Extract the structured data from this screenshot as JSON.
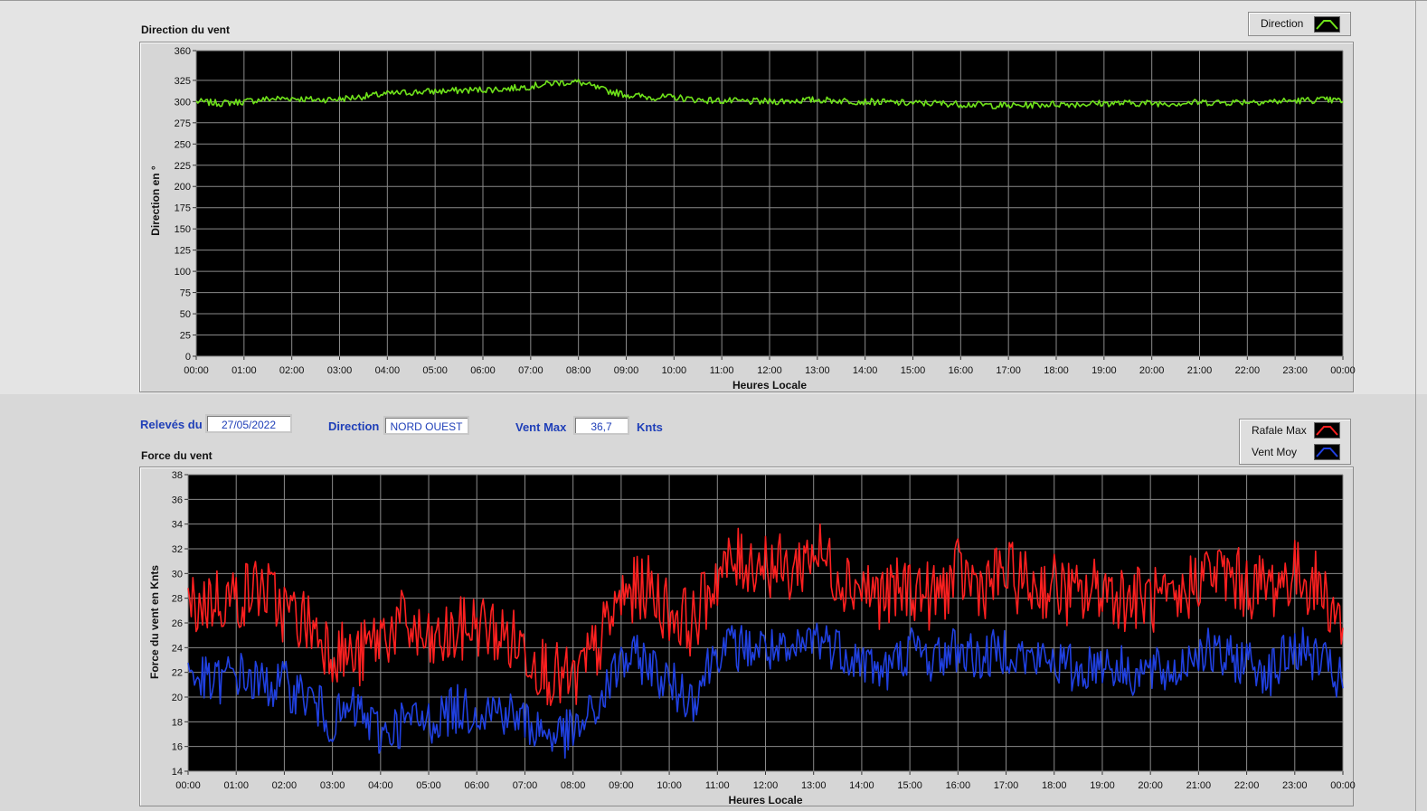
{
  "info": {
    "date_label": "Relevés du",
    "date_value": "27/05/2022",
    "direction_label": "Direction",
    "direction_value": "NORD OUEST",
    "ventmax_label": "Vent Max",
    "ventmax_value": "36,7",
    "unit_label": "Knts"
  },
  "legends": {
    "direction": {
      "label": "Direction",
      "color": "#6fe31a"
    },
    "rafale": {
      "label": "Rafale Max",
      "color": "#ff2020"
    },
    "ventmoy": {
      "label": "Vent Moy",
      "color": "#2040e0"
    }
  },
  "chart_data": [
    {
      "type": "line",
      "title": "Direction du vent",
      "xlabel": "Heures Locale",
      "ylabel": "Direction en °",
      "xlim": [
        0,
        24
      ],
      "ylim": [
        0,
        360
      ],
      "yticks": [
        0,
        25,
        50,
        75,
        100,
        125,
        150,
        175,
        200,
        225,
        250,
        275,
        300,
        325,
        360
      ],
      "xtick_labels": [
        "00:00",
        "01:00",
        "02:00",
        "03:00",
        "04:00",
        "05:00",
        "06:00",
        "07:00",
        "08:00",
        "09:00",
        "10:00",
        "11:00",
        "12:00",
        "13:00",
        "14:00",
        "15:00",
        "16:00",
        "17:00",
        "18:00",
        "19:00",
        "20:00",
        "21:00",
        "22:00",
        "23:00",
        "00:00"
      ],
      "grid": true,
      "legend_position": "top-right",
      "series": [
        {
          "name": "Direction",
          "color": "#6fe31a",
          "x": [
            0,
            0.5,
            1,
            1.5,
            2,
            2.5,
            3,
            3.5,
            4,
            4.5,
            5,
            5.5,
            6,
            6.5,
            7,
            7.5,
            8,
            8.5,
            9,
            9.5,
            10,
            10.5,
            11,
            11.5,
            12,
            12.5,
            13,
            13.5,
            14,
            14.5,
            15,
            15.5,
            16,
            16.5,
            17,
            17.5,
            18,
            18.5,
            19,
            19.5,
            20,
            20.5,
            21,
            21.5,
            22,
            22.5,
            23,
            23.5,
            24
          ],
          "y": [
            300,
            298,
            300,
            303,
            304,
            302,
            303,
            306,
            309,
            311,
            312,
            313,
            314,
            315,
            318,
            322,
            323,
            314,
            308,
            305,
            305,
            302,
            301,
            300,
            300,
            301,
            302,
            301,
            300,
            299,
            298,
            298,
            297,
            296,
            295,
            296,
            297,
            297,
            298,
            298,
            298,
            298,
            299,
            299,
            300,
            300,
            301,
            302,
            301
          ]
        }
      ]
    },
    {
      "type": "line",
      "title": "Force du vent",
      "xlabel": "Heures Locale",
      "ylabel": "Force du vent en Knts",
      "xlim": [
        0,
        24
      ],
      "ylim": [
        14,
        38
      ],
      "yticks": [
        14,
        16,
        18,
        20,
        22,
        24,
        26,
        28,
        30,
        32,
        34,
        36,
        38
      ],
      "xtick_labels": [
        "00:00",
        "01:00",
        "02:00",
        "03:00",
        "04:00",
        "05:00",
        "06:00",
        "07:00",
        "08:00",
        "09:00",
        "10:00",
        "11:00",
        "12:00",
        "13:00",
        "14:00",
        "15:00",
        "16:00",
        "17:00",
        "18:00",
        "19:00",
        "20:00",
        "21:00",
        "22:00",
        "23:00",
        "00:00"
      ],
      "grid": true,
      "legend_position": "top-right",
      "series": [
        {
          "name": "Rafale Max",
          "color": "#ff2020",
          "x": [
            0,
            0.5,
            1,
            1.5,
            2,
            2.5,
            3,
            3.5,
            4,
            4.5,
            5,
            5.5,
            6,
            6.5,
            7,
            7.5,
            8,
            8.5,
            9,
            9.5,
            10,
            10.5,
            11,
            11.5,
            12,
            12.5,
            13,
            13.5,
            14,
            14.5,
            15,
            15.5,
            16,
            16.5,
            17,
            17.5,
            18,
            18.5,
            19,
            19.5,
            20,
            20.5,
            21,
            21.5,
            22,
            22.5,
            23,
            23.5,
            24
          ],
          "y": [
            27,
            28,
            28,
            29,
            27,
            26,
            24,
            23,
            25,
            26,
            24,
            25,
            26,
            25,
            24,
            22,
            21,
            24,
            28,
            29,
            27,
            26,
            30,
            31,
            31,
            30,
            32,
            30,
            29,
            28,
            29,
            28,
            30,
            29,
            30,
            29,
            29,
            28,
            29,
            28,
            28,
            27,
            30,
            30,
            29,
            29,
            30,
            29,
            26
          ]
        },
        {
          "name": "Vent Moy",
          "color": "#2040e0",
          "x": [
            0,
            0.5,
            1,
            1.5,
            2,
            2.5,
            3,
            3.5,
            4,
            4.5,
            5,
            5.5,
            6,
            6.5,
            7,
            7.5,
            8,
            8.5,
            9,
            9.5,
            10,
            10.5,
            11,
            11.5,
            12,
            12.5,
            13,
            13.5,
            14,
            14.5,
            15,
            15.5,
            16,
            16.5,
            17,
            17.5,
            18,
            18.5,
            19,
            19.5,
            20,
            20.5,
            21,
            21.5,
            22,
            22.5,
            23,
            23.5,
            24
          ],
          "y": [
            22,
            21,
            22,
            21,
            21,
            20,
            18,
            19,
            17,
            18,
            18,
            19,
            19,
            19,
            18,
            17,
            17,
            19,
            23,
            23,
            21,
            20,
            24,
            24,
            24,
            23,
            25,
            24,
            23,
            22,
            24,
            23,
            24,
            23,
            24,
            23,
            23,
            22,
            23,
            22,
            22,
            22,
            24,
            23,
            23,
            22,
            24,
            23,
            21
          ]
        }
      ]
    }
  ]
}
